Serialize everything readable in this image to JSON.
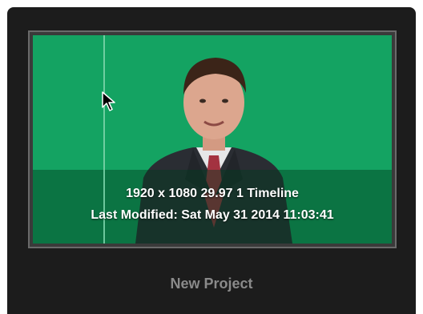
{
  "project": {
    "name": "New Project",
    "resolution_line": "1920 x 1080 29.97 1 Timeline",
    "modified_line": "Last Modified: Sat May 31 2014 11:03:41"
  },
  "colors": {
    "tile_background": "#1c1c1c",
    "thumbnail_green": "#13a060",
    "frame_border": "#6a6a6a",
    "project_name_text": "#8a8a8a"
  },
  "icons": {
    "cursor": "mouse-pointer-icon"
  }
}
